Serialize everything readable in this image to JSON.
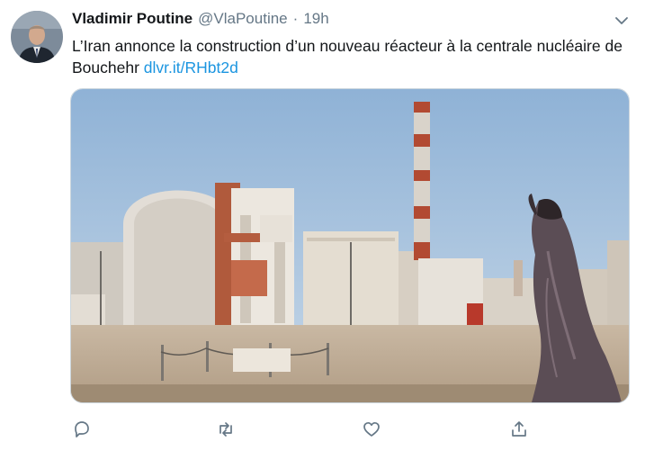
{
  "tweet": {
    "author_name": "Vladimir Poutine",
    "author_handle": "@VlaPoutine",
    "separator": "·",
    "timestamp": "19h",
    "text": "L’Iran annonce la construction d’un nouveau réacteur à la centrale nucléaire de Bouchehr ",
    "link_text": "dlvr.it/RHbt2d"
  },
  "icons": {
    "menu": "chevron-down-icon",
    "reply": "reply-icon",
    "retweet": "retweet-icon",
    "like": "heart-icon",
    "share": "share-icon"
  },
  "colors": {
    "text": "#14171a",
    "secondary": "#657786",
    "link": "#1b95e0"
  }
}
